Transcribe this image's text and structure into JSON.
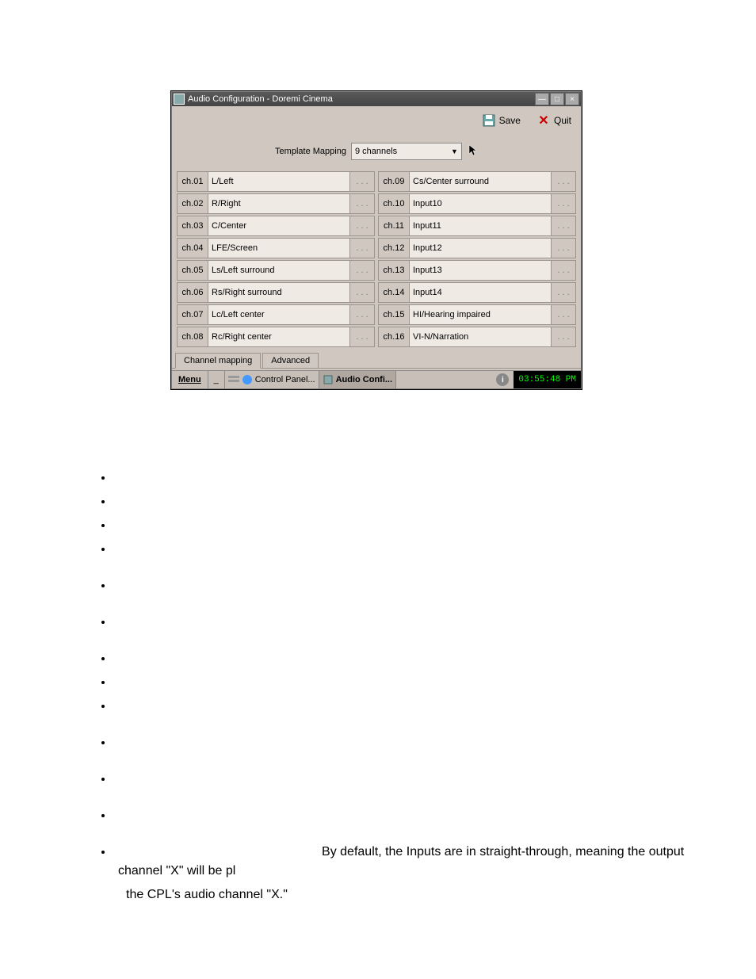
{
  "window": {
    "title": "Audio Configuration - Doremi Cinema",
    "toolbar": {
      "save_label": "Save",
      "quit_label": "Quit"
    },
    "template_label": "Template Mapping",
    "template_value": "9 channels",
    "channels_left": [
      {
        "num": "ch.01",
        "val": "L/Left"
      },
      {
        "num": "ch.02",
        "val": "R/Right"
      },
      {
        "num": "ch.03",
        "val": "C/Center"
      },
      {
        "num": "ch.04",
        "val": "LFE/Screen"
      },
      {
        "num": "ch.05",
        "val": "Ls/Left surround"
      },
      {
        "num": "ch.06",
        "val": "Rs/Right surround"
      },
      {
        "num": "ch.07",
        "val": "Lc/Left center"
      },
      {
        "num": "ch.08",
        "val": "Rc/Right center"
      }
    ],
    "channels_right": [
      {
        "num": "ch.09",
        "val": "Cs/Center surround"
      },
      {
        "num": "ch.10",
        "val": "Input10"
      },
      {
        "num": "ch.11",
        "val": "Input11"
      },
      {
        "num": "ch.12",
        "val": "Input12"
      },
      {
        "num": "ch.13",
        "val": "Input13"
      },
      {
        "num": "ch.14",
        "val": "Input14"
      },
      {
        "num": "ch.15",
        "val": "HI/Hearing impaired"
      },
      {
        "num": "ch.16",
        "val": "VI-N/Narration"
      }
    ],
    "ellipsis": ". . .",
    "tabs": {
      "a": "Channel mapping",
      "b": "Advanced"
    },
    "taskbar": {
      "menu": "Menu",
      "control_panel": "Control Panel...",
      "audio_confi": "Audio Confi...",
      "clock": "03:55:48 PM"
    }
  },
  "doc": {
    "b1": "By default, the Inputs are in straight-through, meaning the output channel \"X\" will be pl",
    "b2": "the CPL's audio channel \"X.\""
  }
}
